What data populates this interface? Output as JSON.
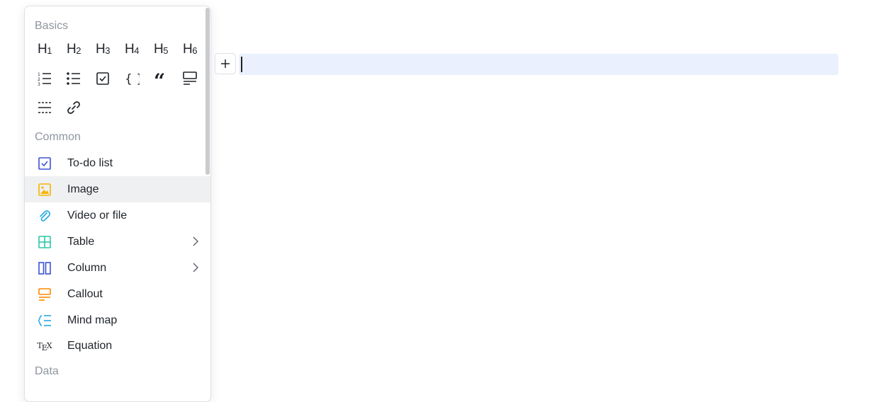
{
  "menu": {
    "sections": {
      "basics": "Basics",
      "common": "Common",
      "data": "Data"
    },
    "headings": [
      {
        "letter": "H",
        "num": "1"
      },
      {
        "letter": "H",
        "num": "2"
      },
      {
        "letter": "H",
        "num": "3"
      },
      {
        "letter": "H",
        "num": "4"
      },
      {
        "letter": "H",
        "num": "5"
      },
      {
        "letter": "H",
        "num": "6"
      }
    ],
    "basic_icons": [
      "ordered-list-icon",
      "bullet-list-icon",
      "checkbox-icon",
      "code-block-icon",
      "quote-icon",
      "callout-icon",
      "divider-icon",
      "link-icon"
    ],
    "items": [
      {
        "label": "To-do list",
        "icon": "todo-icon",
        "color": "#3d52d5"
      },
      {
        "label": "Image",
        "icon": "image-icon",
        "color": "#f5b400",
        "active": true
      },
      {
        "label": "Video or file",
        "icon": "attachment-icon",
        "color": "#25a8e6"
      },
      {
        "label": "Table",
        "icon": "table-icon",
        "color": "#2bc9a5",
        "submenu": true
      },
      {
        "label": "Column",
        "icon": "column-icon",
        "color": "#3d52d5",
        "submenu": true
      },
      {
        "label": "Callout",
        "icon": "callout-icon",
        "color": "#ff8800"
      },
      {
        "label": "Mind map",
        "icon": "mindmap-icon",
        "color": "#25a8e6"
      },
      {
        "label": "Equation",
        "icon": "tex-icon",
        "color": "#1f2329"
      }
    ]
  },
  "colors": {
    "hover_row": "#eff0f1",
    "editor_line": "#eaf0fd",
    "muted": "#8f959e"
  },
  "tex": {
    "t1": "T",
    "t2": "E",
    "t3": "X"
  }
}
